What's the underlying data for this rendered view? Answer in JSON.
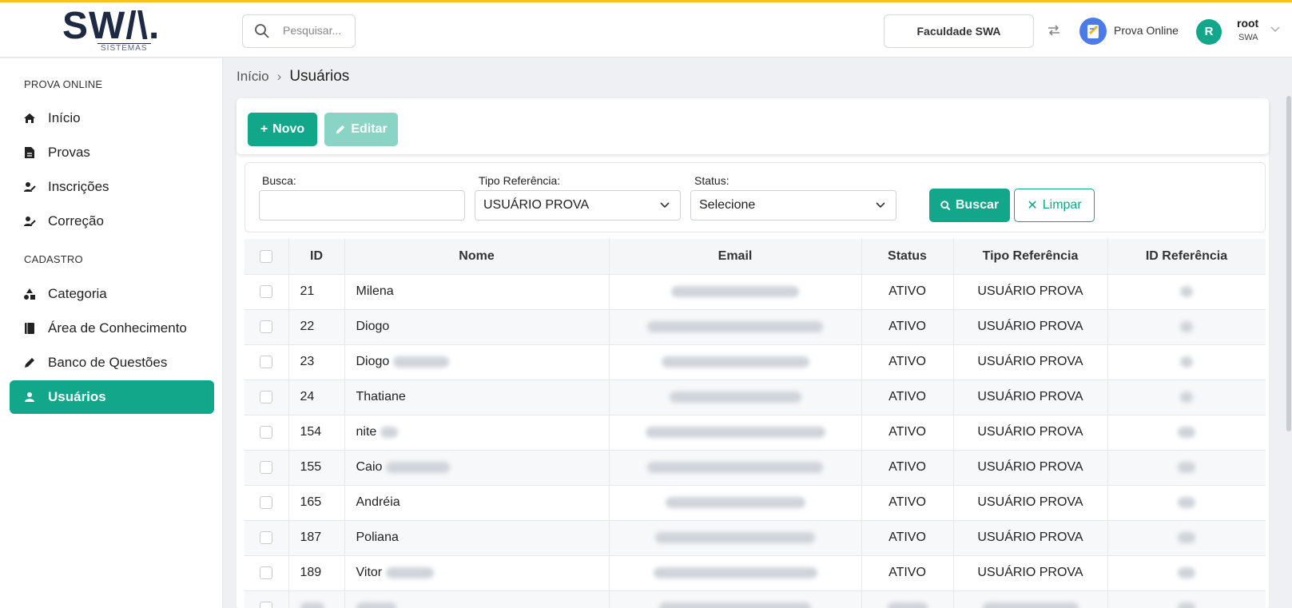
{
  "header": {
    "logo_text": "SW/\\.",
    "logo_sub": "SISTEMAS",
    "search_placeholder": "Pesquisar...",
    "institution": "Faculdade SWA",
    "app_name": "Prova Online",
    "user_initial": "R",
    "user_name": "root",
    "user_org": "SWA"
  },
  "sidebar": {
    "section1": "PROVA ONLINE",
    "section2": "CADASTRO",
    "items": [
      {
        "label": "Início",
        "icon": "home-icon"
      },
      {
        "label": "Provas",
        "icon": "document-icon"
      },
      {
        "label": "Inscrições",
        "icon": "user-edit-icon"
      },
      {
        "label": "Correção",
        "icon": "user-edit-icon"
      },
      {
        "label": "Categoria",
        "icon": "shapes-icon"
      },
      {
        "label": "Área de Conhecimento",
        "icon": "book-icon"
      },
      {
        "label": "Banco de Questões",
        "icon": "pencil-icon"
      },
      {
        "label": "Usuários",
        "icon": "user-icon",
        "active": true
      }
    ]
  },
  "breadcrumb": {
    "home": "Início",
    "current": "Usuários"
  },
  "toolbar": {
    "novo_label": "Novo",
    "editar_label": "Editar"
  },
  "filters": {
    "busca_label": "Busca:",
    "busca_value": "",
    "tipo_label": "Tipo Referência:",
    "tipo_value": "USUÁRIO PROVA",
    "status_label": "Status:",
    "status_value": "Selecione",
    "buscar_label": "Buscar",
    "limpar_label": "Limpar"
  },
  "table": {
    "columns": [
      "ID",
      "Nome",
      "Email",
      "Status",
      "Tipo Referência",
      "ID Referência"
    ],
    "rows": [
      {
        "id": "21",
        "nome": "Milena",
        "status": "ATIVO",
        "tipo": "USUÁRIO PROVA"
      },
      {
        "id": "22",
        "nome": "Diogo",
        "status": "ATIVO",
        "tipo": "USUÁRIO PROVA"
      },
      {
        "id": "23",
        "nome": "Diogo",
        "status": "ATIVO",
        "tipo": "USUÁRIO PROVA"
      },
      {
        "id": "24",
        "nome": "Thatiane",
        "status": "ATIVO",
        "tipo": "USUÁRIO PROVA"
      },
      {
        "id": "154",
        "nome": "nite",
        "status": "ATIVO",
        "tipo": "USUÁRIO PROVA"
      },
      {
        "id": "155",
        "nome": "Caio",
        "status": "ATIVO",
        "tipo": "USUÁRIO PROVA"
      },
      {
        "id": "165",
        "nome": "Andréia",
        "status": "ATIVO",
        "tipo": "USUÁRIO PROVA"
      },
      {
        "id": "187",
        "nome": "Poliana",
        "status": "ATIVO",
        "tipo": "USUÁRIO PROVA"
      },
      {
        "id": "189",
        "nome": "Vitor",
        "status": "ATIVO",
        "tipo": "USUÁRIO PROVA"
      }
    ]
  },
  "colors": {
    "accent": "#12a68b",
    "top_border": "#f5c518"
  }
}
